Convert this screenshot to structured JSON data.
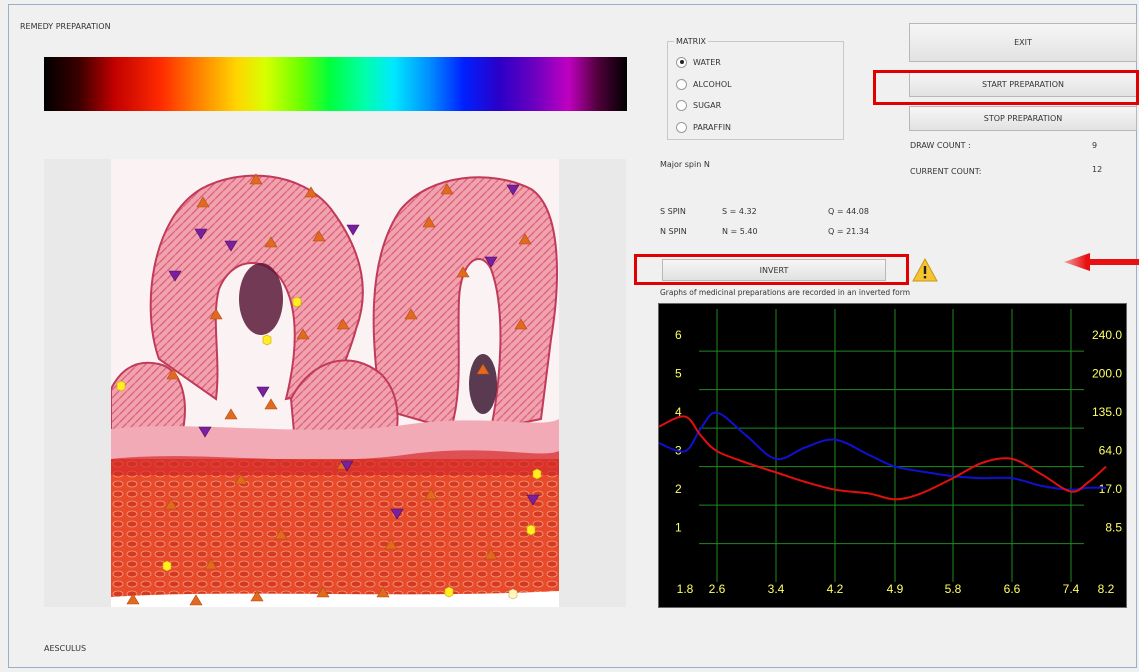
{
  "window": {
    "title": "REMEDY PREPARATION"
  },
  "matrix": {
    "legend": "MATRIX",
    "options": [
      {
        "label": "WATER",
        "selected": true
      },
      {
        "label": "ALCOHOL",
        "selected": false
      },
      {
        "label": "SUGAR",
        "selected": false
      },
      {
        "label": "PARAFFIN",
        "selected": false
      }
    ]
  },
  "controls": {
    "exit_label": "EXIT",
    "start_label": "START PREPARATION",
    "stop_label": "STOP PREPARATION",
    "invert_label": "INVERT"
  },
  "counts": {
    "draw_label": "DRAW COUNT :",
    "draw_value": "9",
    "current_label": "CURRENT COUNT:",
    "current_value": "12"
  },
  "spin": {
    "major": "Major spin N",
    "s_label": "S SPIN",
    "s_value": "S = 4.32",
    "s_q": "Q = 44.08",
    "n_label": "N SPIN",
    "n_value": "N = 5.40",
    "n_q": "Q = 21.34"
  },
  "note": "Graphs of medicinal preparations are recorded in an inverted form",
  "remedy_name": "AESCULUS",
  "icons": {
    "warning": "warning-icon",
    "arrow": "arrow-left-icon"
  },
  "colors": {
    "highlight": "#e00000",
    "grid": "#1f8a1f",
    "axis_text": "#ffff66",
    "series_blue": "#1010d0",
    "series_red": "#e01010"
  },
  "chart_data": {
    "type": "line",
    "x_ticks": [
      "1.8",
      "2.6",
      "3.4",
      "4.2",
      "4.9",
      "5.8",
      "6.6",
      "7.4",
      "8.2"
    ],
    "y_left_ticks": [
      "6",
      "5",
      "4",
      "3",
      "2",
      "1"
    ],
    "y_right_ticks": [
      "240.0",
      "200.0",
      "135.0",
      "64.0",
      "17.0",
      "8.5"
    ],
    "ylim": [
      0.6,
      6.6
    ],
    "series": [
      {
        "color": "#1010d0",
        "x": [
          1.8,
          2.2,
          2.6,
          3.0,
          3.4,
          3.8,
          4.2,
          4.6,
          4.9,
          5.4,
          5.8,
          6.2,
          6.6,
          7.0,
          7.4,
          7.8,
          8.2
        ],
        "y": [
          3.4,
          4.0,
          4.4,
          3.8,
          3.2,
          3.5,
          3.7,
          3.3,
          3.0,
          2.85,
          2.75,
          2.7,
          2.7,
          2.5,
          2.4,
          2.45,
          2.45
        ]
      },
      {
        "color": "#e01010",
        "x": [
          1.8,
          2.2,
          2.6,
          3.0,
          3.4,
          3.8,
          4.2,
          4.6,
          4.9,
          5.3,
          5.8,
          6.2,
          6.6,
          7.0,
          7.4,
          7.8,
          8.2
        ],
        "y": [
          4.3,
          3.8,
          3.4,
          3.1,
          2.85,
          2.6,
          2.4,
          2.3,
          2.15,
          2.3,
          2.7,
          3.1,
          3.2,
          2.8,
          2.35,
          2.6,
          3.0
        ]
      }
    ]
  }
}
